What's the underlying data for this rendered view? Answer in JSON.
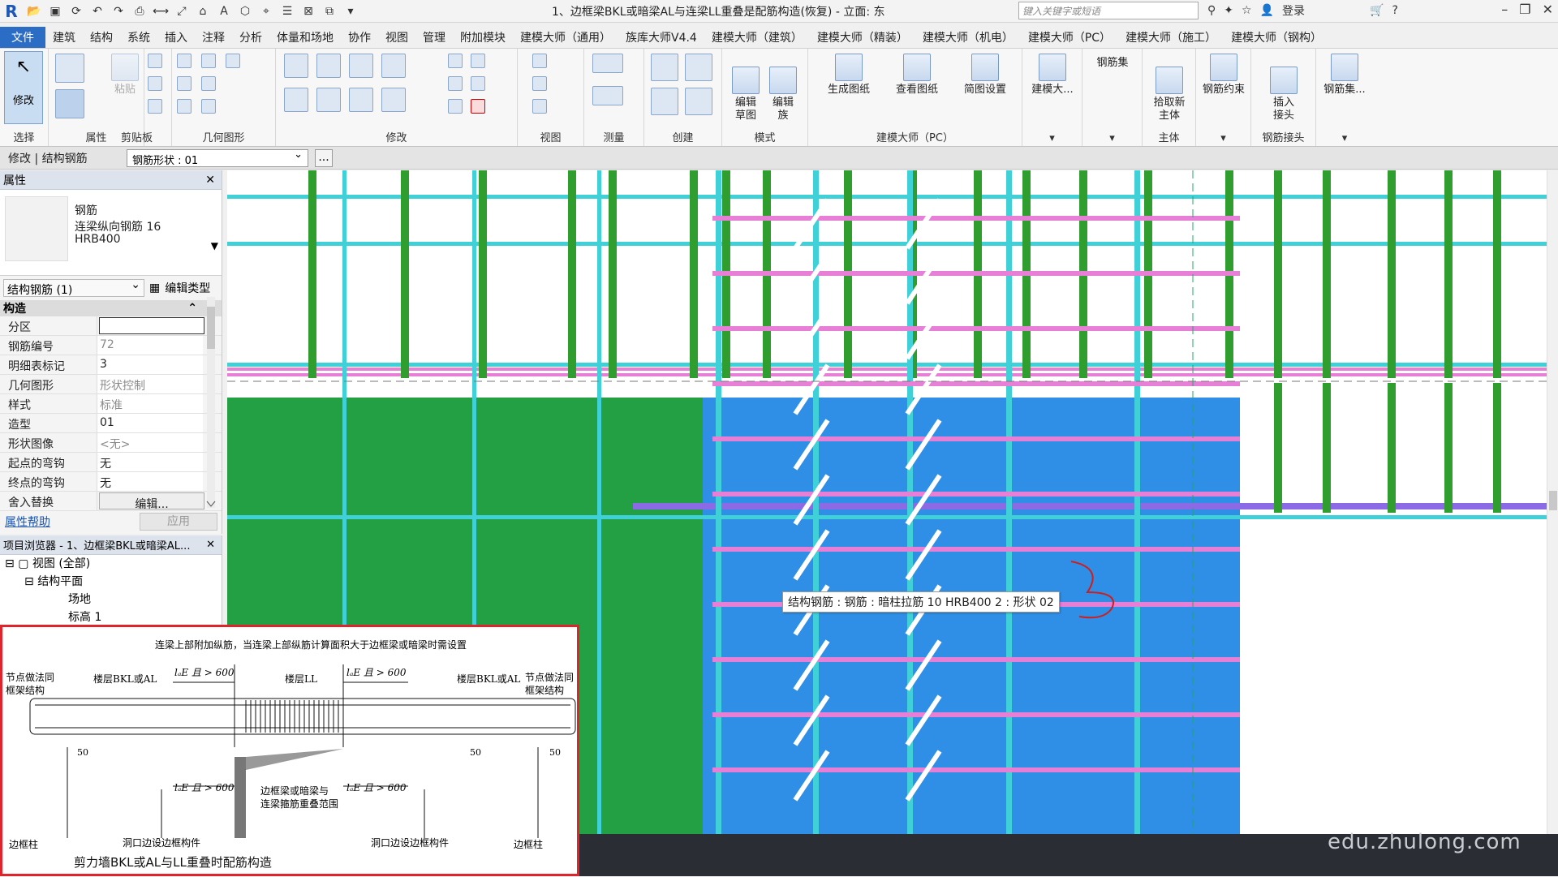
{
  "app": {
    "logo": "R",
    "title": "1、边框梁BKL或暗梁AL与连梁LL重叠是配筋构造(恢复) - 立面: 东",
    "search_placeholder": "键入关键字或短语",
    "login": "登录",
    "help": "?"
  },
  "tabs": [
    {
      "label": "文件",
      "active": true
    },
    {
      "label": "建筑"
    },
    {
      "label": "结构"
    },
    {
      "label": "系统"
    },
    {
      "label": "插入"
    },
    {
      "label": "注释"
    },
    {
      "label": "分析"
    },
    {
      "label": "体量和场地"
    },
    {
      "label": "协作"
    },
    {
      "label": "视图"
    },
    {
      "label": "管理"
    },
    {
      "label": "附加模块"
    },
    {
      "label": "建模大师（通用）"
    },
    {
      "label": "族库大师V4.4"
    },
    {
      "label": "建模大师（建筑）"
    },
    {
      "label": "建模大师（精装）"
    },
    {
      "label": "建模大师（机电）"
    },
    {
      "label": "建模大师（PC）"
    },
    {
      "label": "建模大师（施工）"
    },
    {
      "label": "建模大师（钢构）"
    }
  ],
  "ribbon": {
    "modify": "修改",
    "paste": "粘贴",
    "select": "选择",
    "properties": "属性",
    "clipboard": "剪贴板",
    "geometry": "几何图形",
    "modify_panel": "修改",
    "view_panel": "视图",
    "measure": "测量",
    "create": "创建",
    "mode": "模式",
    "edit_sketch": "编辑\n草图",
    "edit_family": "编辑\n族",
    "gen_drawing": "生成图纸",
    "view_drawing": "查看图纸",
    "sketch_settings": "简图设置",
    "pc_group": "建模大师（PC）",
    "build_master": "建模大...",
    "rebar_set": "钢筋集",
    "pick_host": "拾取新\n主体",
    "host": "主体",
    "rebar_constraint": "钢筋约束",
    "insert_coupler": "插入\n接头",
    "rebar_coupler": "钢筋接头",
    "rebar_set2": "钢筋集..."
  },
  "context": {
    "label": "修改 | 结构钢筋",
    "shape_select": "钢筋形状 : 01",
    "more": "..."
  },
  "properties": {
    "title": "属性",
    "type_line1": "钢筋",
    "type_line2": "连梁纵向钢筋 16",
    "type_line3": "HRB400",
    "filter": "结构钢筋 (1)",
    "edit_type": "编辑类型",
    "group": "构造",
    "rows": [
      {
        "k": "分区",
        "v": ""
      },
      {
        "k": "钢筋编号",
        "v": "72"
      },
      {
        "k": "明细表标记",
        "v": "3"
      },
      {
        "k": "几何图形",
        "v": "形状控制"
      },
      {
        "k": "样式",
        "v": "标准"
      },
      {
        "k": "造型",
        "v": "01"
      },
      {
        "k": "形状图像",
        "v": "<无>"
      },
      {
        "k": "起点的弯钩",
        "v": "无"
      },
      {
        "k": "终点的弯钩",
        "v": "无"
      },
      {
        "k": "舍入替换",
        "v": "编辑..."
      }
    ],
    "help": "属性帮助",
    "apply": "应用"
  },
  "browser": {
    "title": "项目浏览器 - 1、边框梁BKL或暗梁AL...",
    "items": [
      "视图 (全部)",
      "结构平面",
      "场地",
      "标高 1"
    ]
  },
  "tooltip": "结构钢筋 : 钢筋 : 暗柱拉筋 10 HRB400 2 : 形状 02",
  "inset": {
    "top_note": "连梁上部附加纵筋，当连梁上部纵筋计算面积大于边框梁或暗梁时需设置",
    "left_note1": "节点做法同",
    "left_note2": "框架结构",
    "right_note1": "节点做法同",
    "right_note2": "框架结构",
    "beam_left": "楼层BKL或AL",
    "beam_mid": "楼层LL",
    "beam_right": "楼层BKL或AL",
    "lae": "lₐE 且 > 600",
    "overlap1": "边框梁或暗梁与",
    "overlap2": "连梁箍筋重叠范围",
    "fifty": "50",
    "col_edge": "边框柱",
    "opening_member": "洞口边设边框构件",
    "caption": "剪力墙BKL或AL与LL重叠时配筋构造"
  },
  "watermark": "edu.zhulong.com",
  "colors": {
    "accent": "#2b6cc4",
    "rebar_green": "#2f9e2f",
    "rebar_cyan": "#3fd0d8",
    "rebar_pink": "#e87fd6",
    "wall_green": "#23a043",
    "column_blue": "#2f8fe6",
    "tie_purple": "#8c6ae6"
  }
}
